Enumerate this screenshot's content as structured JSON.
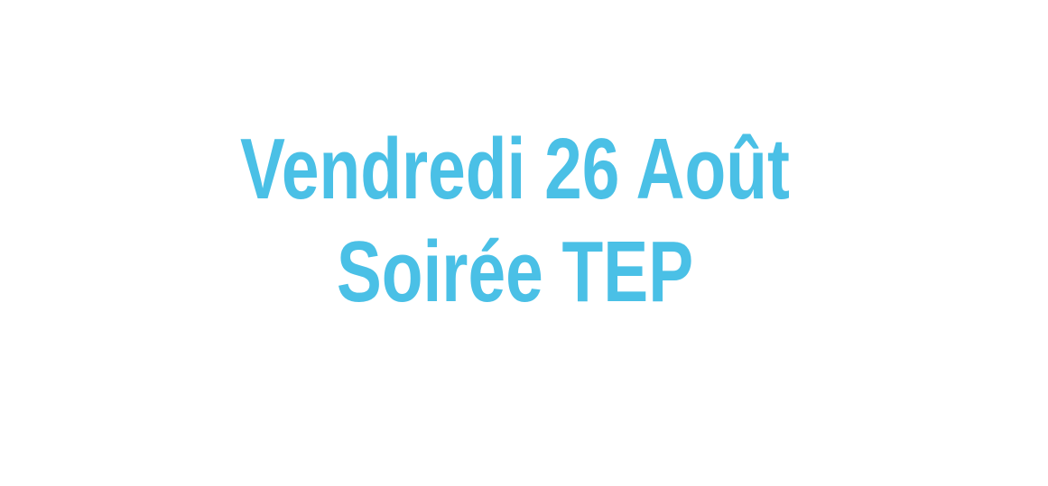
{
  "announcement": {
    "line1": "Vendredi 26 Août",
    "line2": "Soirée TEP"
  },
  "colors": {
    "text": "#4ac0e6",
    "background": "#ffffff"
  }
}
